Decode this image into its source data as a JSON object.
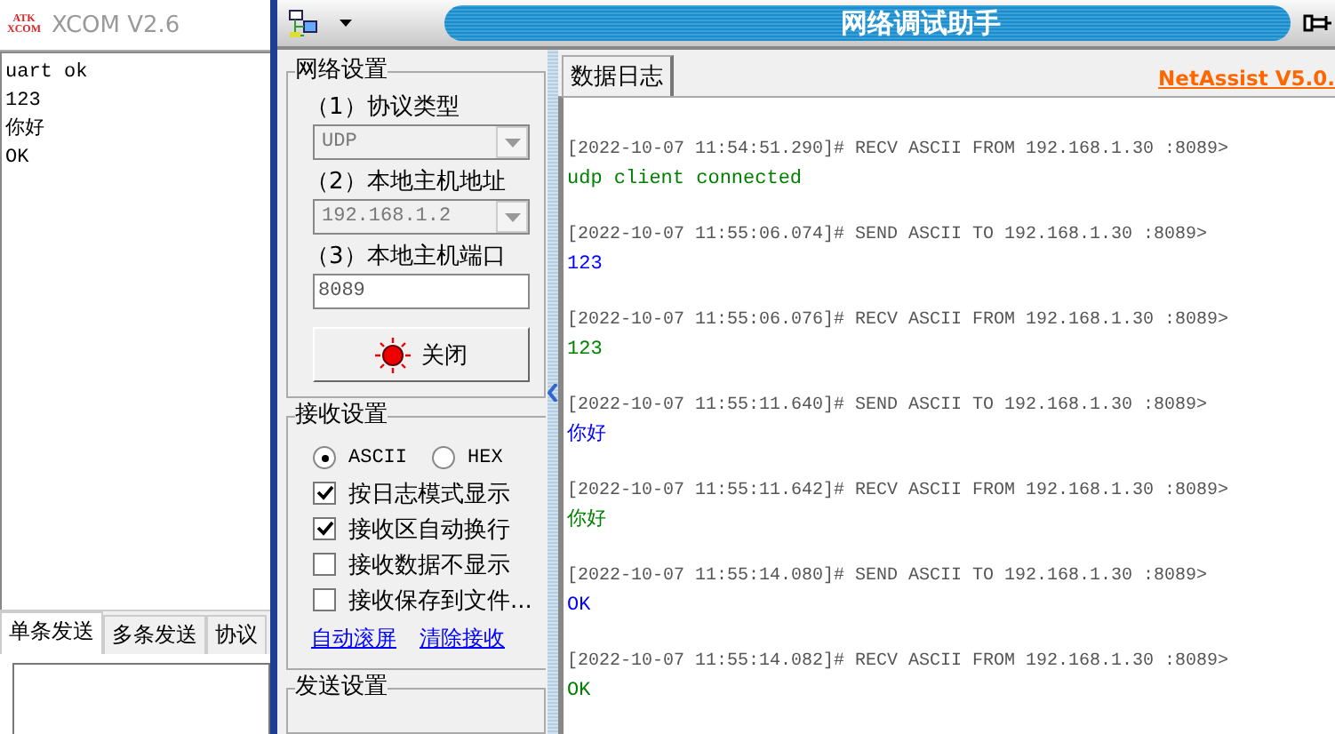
{
  "xcom": {
    "logo": [
      "ATK",
      "XCOM"
    ],
    "title": "XCOM V2.6",
    "received_lines": [
      "uart ok",
      "123",
      "你好",
      "OK"
    ],
    "tabs": [
      {
        "label": "单条发送",
        "selected": true
      },
      {
        "label": "多条发送",
        "selected": false
      },
      {
        "label": "协议",
        "selected": false
      }
    ]
  },
  "netassist": {
    "title": "网络调试助手",
    "network_settings": {
      "title": "网络设置",
      "fields": [
        {
          "label": "（1）协议类型",
          "value": "UDP",
          "kind": "dropdown",
          "disabled": true
        },
        {
          "label": "（2）本地主机地址",
          "value": "192.168.1.2",
          "kind": "dropdown",
          "disabled": true
        },
        {
          "label": "（3）本地主机端口",
          "value": "8089",
          "kind": "input",
          "disabled": false
        }
      ],
      "button": "关闭"
    },
    "receive_settings": {
      "title": "接收设置",
      "modes": [
        {
          "label": "ASCII",
          "selected": true
        },
        {
          "label": "HEX",
          "selected": false
        }
      ],
      "options": [
        {
          "label": "按日志模式显示",
          "checked": true
        },
        {
          "label": "接收区自动换行",
          "checked": true
        },
        {
          "label": "接收数据不显示",
          "checked": false
        },
        {
          "label": "接收保存到文件...",
          "checked": false
        }
      ],
      "links": [
        "自动滚屏",
        "清除接收"
      ]
    },
    "send_settings": {
      "title": "发送设置"
    },
    "log_tab": {
      "label": "数据日志",
      "selected": true
    },
    "version_link": "NetAssist V5.0.",
    "log": [
      {
        "header": "[2022-10-07 11:54:51.290]# RECV ASCII FROM 192.168.1.30 :8089>",
        "data": "udp client connected",
        "color": "#008000"
      },
      {
        "header": "[2022-10-07 11:55:06.074]# SEND ASCII TO 192.168.1.30 :8089>",
        "data": "123",
        "color": "#0000ff"
      },
      {
        "header": "[2022-10-07 11:55:06.076]# RECV ASCII FROM 192.168.1.30 :8089>",
        "data": "123",
        "color": "#008000"
      },
      {
        "header": "[2022-10-07 11:55:11.640]# SEND ASCII TO 192.168.1.30 :8089>",
        "data": "你好",
        "color": "#0000ff"
      },
      {
        "header": "[2022-10-07 11:55:11.642]# RECV ASCII FROM 192.168.1.30 :8089>",
        "data": "你好",
        "color": "#008000"
      },
      {
        "header": "[2022-10-07 11:55:14.080]# SEND ASCII TO 192.168.1.30 :8089>",
        "data": "OK",
        "color": "#0000ff"
      },
      {
        "header": "[2022-10-07 11:55:14.082]# RECV ASCII FROM 192.168.1.30 :8089>",
        "data": "OK",
        "color": "#008000"
      }
    ]
  }
}
